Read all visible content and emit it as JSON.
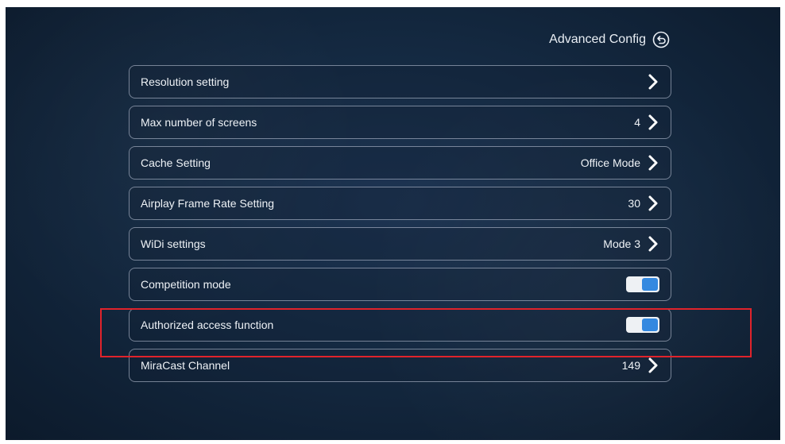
{
  "header": {
    "title": "Advanced Config",
    "back_icon": "back-arrow-icon"
  },
  "rows": [
    {
      "label": "Resolution setting",
      "value": "",
      "control": "chevron"
    },
    {
      "label": "Max number of screens",
      "value": "4",
      "control": "chevron"
    },
    {
      "label": "Cache Setting",
      "value": "Office Mode",
      "control": "chevron"
    },
    {
      "label": "Airplay Frame Rate Setting",
      "value": "30",
      "control": "chevron"
    },
    {
      "label": "WiDi settings",
      "value": "Mode 3",
      "control": "chevron"
    },
    {
      "label": "Competition mode",
      "value": "",
      "control": "toggle",
      "toggle_on": true
    },
    {
      "label": "Authorized access function",
      "value": "",
      "control": "toggle",
      "toggle_on": true
    },
    {
      "label": "MiraCast Channel",
      "value": "149",
      "control": "chevron"
    }
  ],
  "colors": {
    "toggle_on": "#2f86df",
    "highlight_box": "#e0232b",
    "background": "#142941"
  }
}
